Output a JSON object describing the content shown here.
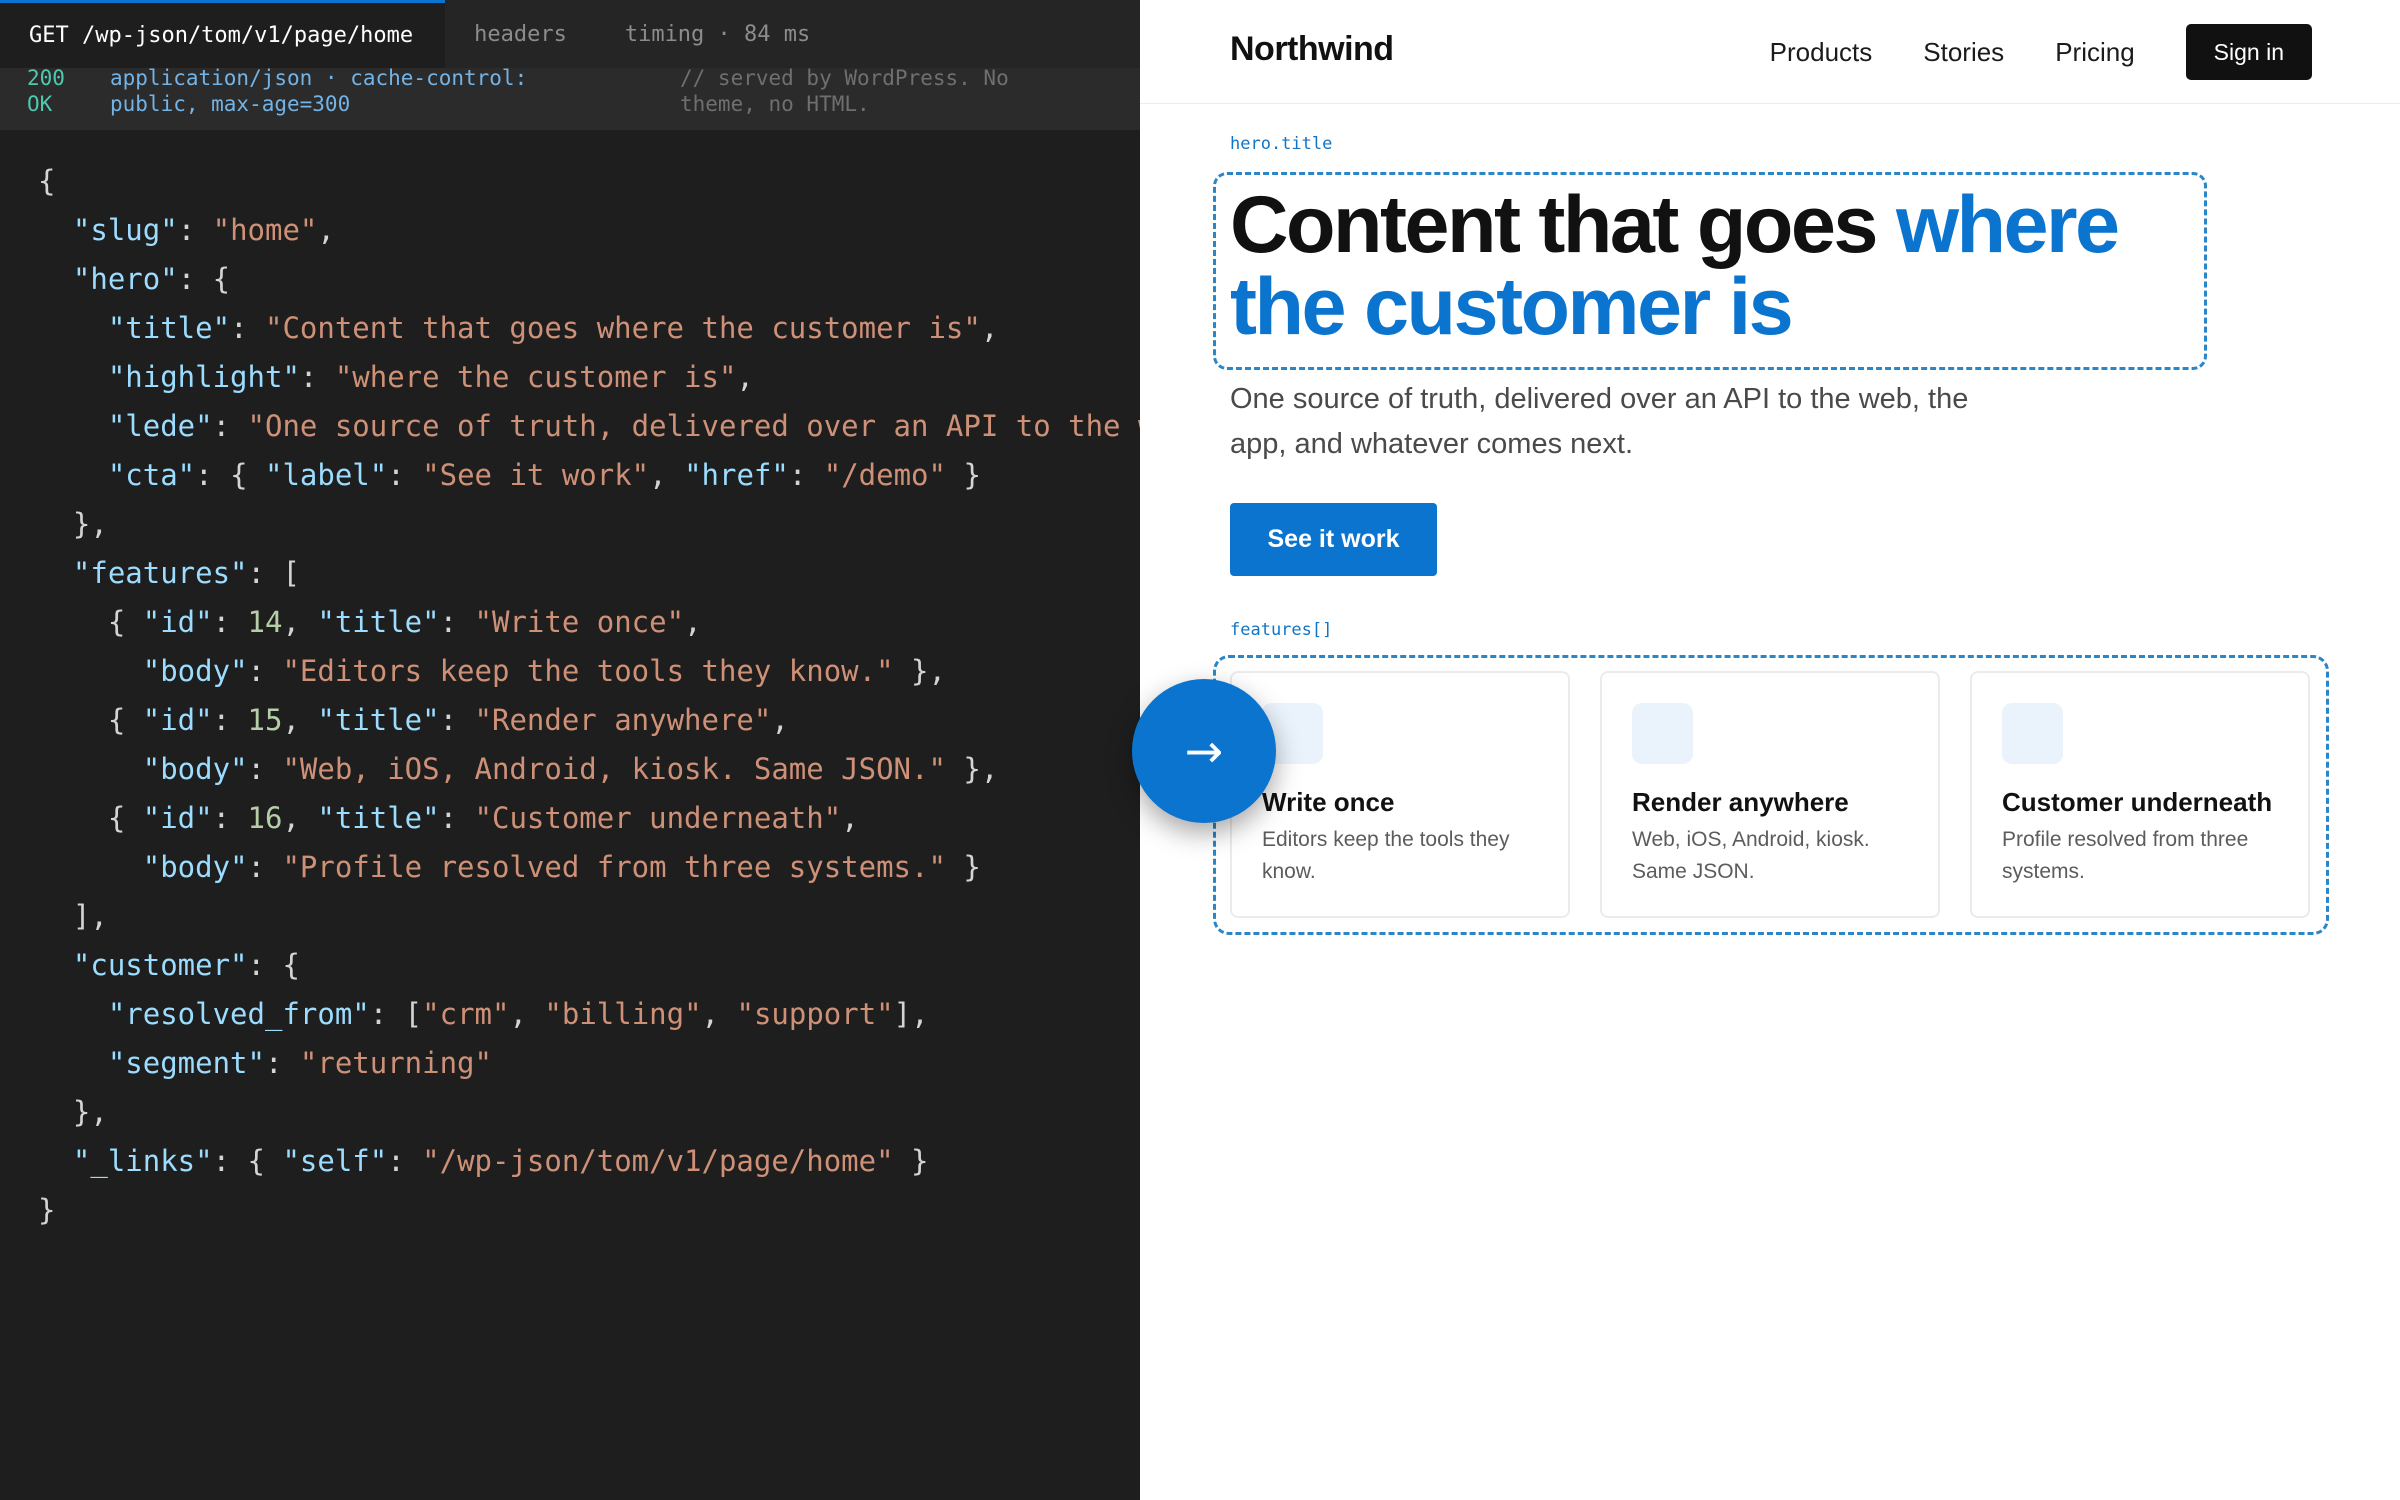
{
  "api": {
    "tabs": [
      "GET /wp-json/tom/v1/page/home",
      "headers",
      "timing · 84 ms"
    ],
    "status": {
      "code": "200",
      "code_text": "OK",
      "content_type_line1": "application/json · cache-control:",
      "content_type_line2": "public, max-age=300",
      "note_line1": "// served by WordPress. No",
      "note_line2": "theme, no HTML."
    },
    "response": {
      "slug": "home",
      "hero_title": "Content that goes where the customer is",
      "hero_highlight": "where the customer is",
      "hero_lede": "One source of truth, delivered over an API to the w",
      "cta_label": "See it work",
      "cta_href": "/demo",
      "features": [
        {
          "id": "14",
          "title": "Write once",
          "body": "Editors keep the tools they know."
        },
        {
          "id": "15",
          "title": "Render anywhere",
          "body": "Web, iOS, Android, kiosk. Same JSON."
        },
        {
          "id": "16",
          "title": "Customer underneath",
          "body": "Profile resolved from three systems."
        }
      ],
      "resolved_from": [
        "crm",
        "billing",
        "support"
      ],
      "segment": "returning",
      "self_link": "/wp-json/tom/v1/page/home"
    }
  },
  "site": {
    "brand": "Northwind",
    "nav": [
      "Products",
      "Stories",
      "Pricing"
    ],
    "signin": "Sign in",
    "hero_tag": "hero.title",
    "hero_title_lead": "Content that goes ",
    "hero_title_highlight": "where the customer is",
    "lede": "One source of truth, delivered over an API to the web, the app, and whatever comes next.",
    "cta": "See it work",
    "features_tag": "features[]",
    "features": [
      {
        "title": "Write once",
        "body": "Editors keep the tools they know."
      },
      {
        "title": "Render anywhere",
        "body": "Web, iOS, Android, kiosk. Same JSON."
      },
      {
        "title": "Customer underneath",
        "body": "Profile resolved from three systems."
      }
    ],
    "arrow_icon": "right-arrow-icon",
    "arrow_glyph": "→"
  },
  "colors": {
    "accent": "#0b74cf",
    "code_bg": "#1e1e1e",
    "json_key": "#9cdcfe",
    "json_string": "#ce9178",
    "json_number": "#b5cea8"
  }
}
